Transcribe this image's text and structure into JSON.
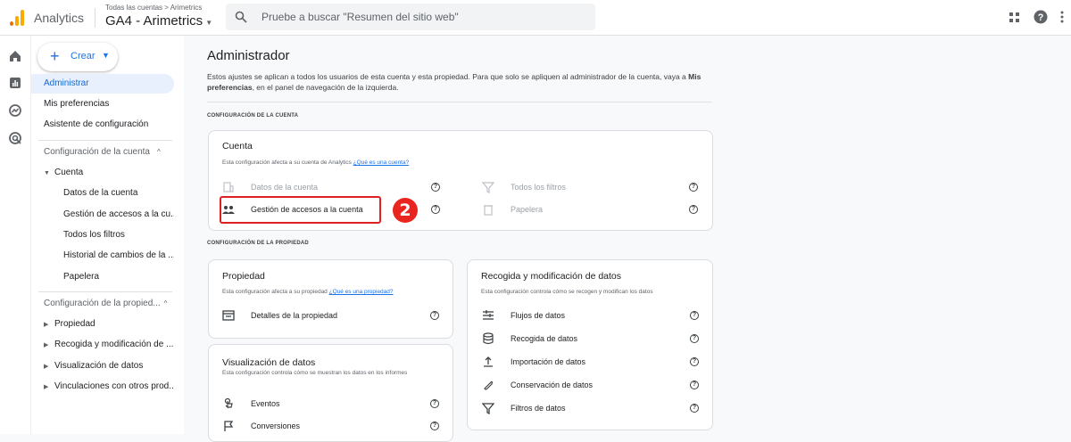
{
  "header": {
    "app_name": "Analytics",
    "breadcrumb": "Todas las cuentas > Arimetrics",
    "property_name": "GA4 - Arimetrics",
    "search_placeholder": "Pruebe a buscar \"Resumen del sitio web\""
  },
  "nav": {
    "create_label": "Crear",
    "items": [
      {
        "label": "Administrar"
      },
      {
        "label": "Mis preferencias"
      },
      {
        "label": "Asistente de configuración"
      },
      {
        "label": "Configuración de la cuenta"
      },
      {
        "label": "Cuenta"
      },
      {
        "label": "Datos de la cuenta"
      },
      {
        "label": "Gestión de accesos a la cu..."
      },
      {
        "label": "Todos los filtros"
      },
      {
        "label": "Historial de cambios de la ..."
      },
      {
        "label": "Papelera"
      },
      {
        "label": "Configuración de la propied..."
      },
      {
        "label": "Propiedad"
      },
      {
        "label": "Recogida y modificación de ..."
      },
      {
        "label": "Visualización de datos"
      },
      {
        "label": "Vinculaciones con otros prod..."
      }
    ]
  },
  "main": {
    "title": "Administrador",
    "description_1": "Estos ajustes se aplican a todos los usuarios de esta cuenta y esta propiedad. Para que solo se apliquen al administrador de la cuenta, vaya a ",
    "description_bold": "Mis preferencias",
    "description_2": ", en el panel de navegación de la izquierda.",
    "section_account": "CONFIGURACIÓN DE LA CUENTA",
    "section_property": "CONFIGURACIÓN DE LA PROPIEDAD",
    "account_card": {
      "title": "Cuenta",
      "subtitle": "Esta configuración afecta a su cuenta de Analytics ",
      "link": "¿Qué es una cuenta?",
      "rows": [
        "Datos de la cuenta",
        "Gestión de accesos a la cuenta",
        "Todos los filtros",
        "Papelera"
      ]
    },
    "property_card": {
      "title": "Propiedad",
      "subtitle": "Esta configuración afecta a su propiedad ",
      "link": "¿Qué es una propiedad?",
      "rows": [
        "Detalles de la propiedad"
      ]
    },
    "data_card": {
      "title": "Recogida y modificación de datos",
      "subtitle": "Esta configuración controla cómo se recogen y modifican los datos",
      "rows": [
        "Flujos de datos",
        "Recogida de datos",
        "Importación de datos",
        "Conservación de datos",
        "Filtros de datos"
      ]
    },
    "display_card": {
      "title": "Visualización de datos",
      "subtitle": "Esta configuración controla cómo se muestran los datos en los informes",
      "rows": [
        "Eventos",
        "Conversiones"
      ]
    },
    "step_badge": "2"
  },
  "colors": {
    "accent": "#1a73e8",
    "highlight": "#e02020",
    "logo_orange": "#f9ab00",
    "logo_dark": "#e37400"
  }
}
